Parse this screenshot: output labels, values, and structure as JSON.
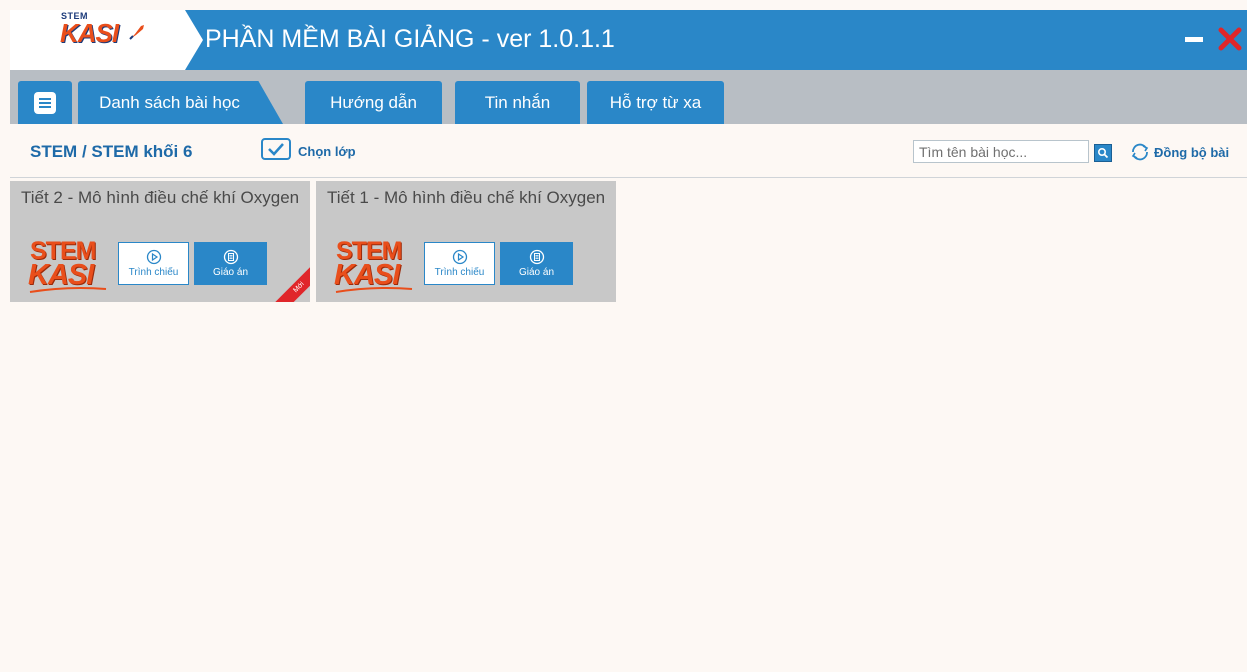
{
  "app": {
    "title": "PHẦN MỀM BÀI GIẢNG - ver 1.0.1.1",
    "logo_small": "STEM",
    "logo_main": "KASI"
  },
  "tabs": [
    {
      "label": "Danh sách bài học",
      "active": true
    },
    {
      "label": "Hướng dẫn",
      "active": false
    },
    {
      "label": "Tin nhắn",
      "active": false
    },
    {
      "label": "Hỗ trợ từ xa",
      "active": false
    }
  ],
  "toolbar": {
    "breadcrumb": "STEM / STEM khối 6",
    "select_class_label": "Chọn lớp",
    "select_class_checked": true,
    "search_placeholder": "Tìm tên bài học...",
    "sync_label": "Đồng bộ bài"
  },
  "lessons": [
    {
      "title": "Tiết 2 - Mô hình điều chế khí Oxygen",
      "logo_top": "STEM",
      "logo_bottom": "KASI",
      "present_label": "Trình chiếu",
      "lesson_plan_label": "Giáo án",
      "new_badge": "Mới"
    },
    {
      "title": "Tiết 1 - Mô hình điều chế khí Oxygen",
      "logo_top": "STEM",
      "logo_bottom": "KASI",
      "present_label": "Trình chiếu",
      "lesson_plan_label": "Giáo án"
    }
  ],
  "colors": {
    "primary": "#2a87c8",
    "tabbar": "#b8bec4",
    "background": "#fdf8f4",
    "card": "#c8c8c8",
    "brand_orange": "#e94e1b",
    "close_red": "#e0262a"
  },
  "icons": {
    "minimize": "minimize-icon",
    "close": "close-icon",
    "menu": "menu-icon",
    "check": "check-icon",
    "search": "search-icon",
    "sync": "sync-icon",
    "play": "play-icon",
    "document": "document-icon"
  }
}
